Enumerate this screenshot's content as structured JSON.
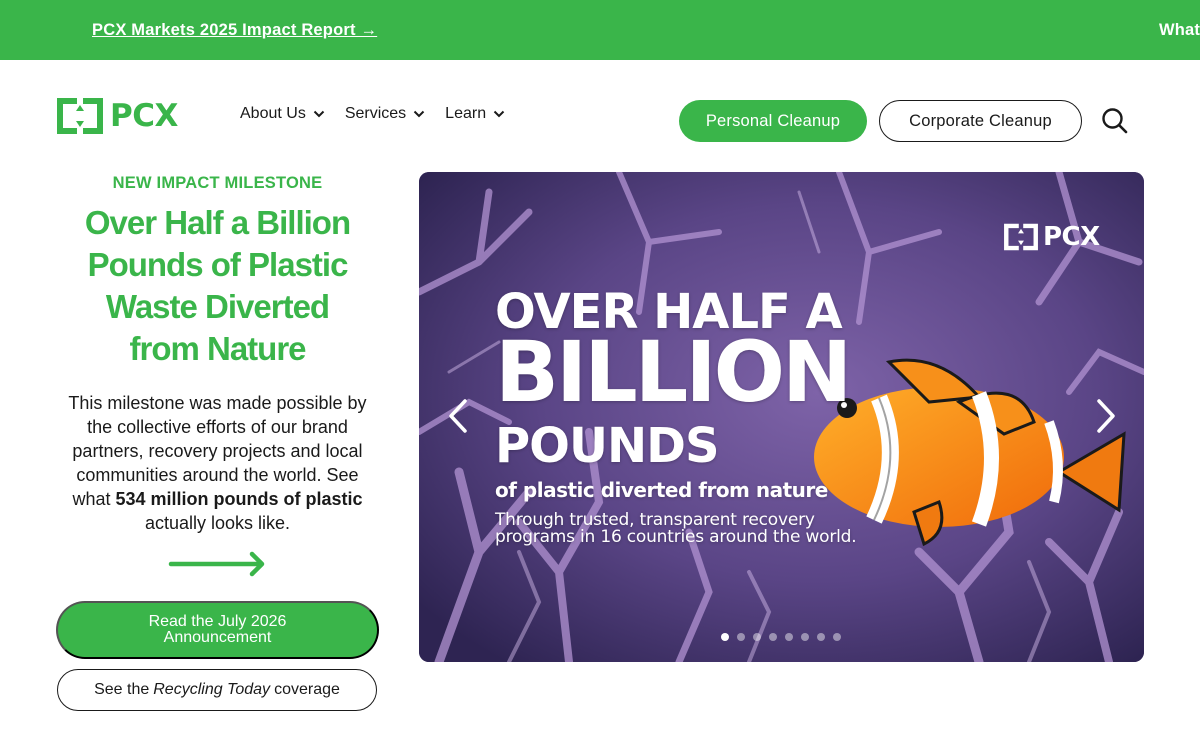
{
  "announcement": {
    "primary_link": "PCX Markets 2025 Impact Report →",
    "secondary_link": "What"
  },
  "header": {
    "logo_text": "PCX",
    "nav": [
      {
        "label": "About Us"
      },
      {
        "label": "Services"
      },
      {
        "label": "Learn"
      }
    ],
    "personal_cleanup": "Personal Cleanup",
    "corporate_cleanup": "Corporate Cleanup"
  },
  "hero": {
    "eyebrow": "NEW IMPACT MILESTONE",
    "headline_lines": [
      "Over Half a Billion",
      "Pounds of Plastic",
      "Waste Diverted",
      "from Nature"
    ],
    "body_before": "This milestone was made possible by the collective efforts of our brand partners, recovery projects and local communities around the world. See what ",
    "body_bold": "534 million pounds of plastic",
    "body_after": " actually looks like.",
    "read_button": "Read the July 2026 Announcement",
    "coverage_prefix": "See the",
    "coverage_italic": "Recycling Today",
    "coverage_suffix": "coverage"
  },
  "carousel": {
    "logo_text": "PCX",
    "line1": "OVER HALF A",
    "line2": "BILLION",
    "line3": "POUNDS",
    "line4": "of plastic diverted from nature",
    "line5": "Through trusted, transparent recovery programs in 16 countries around the world.",
    "slide_count": 8,
    "active_index": 0
  },
  "colors": {
    "brand_green": "#3ab54a",
    "text_dark": "#1a1a1a"
  },
  "icons": {
    "search": "search-icon",
    "nav_chevron": "chevron-down-icon",
    "arrow": "arrow-right-icon",
    "prev": "chevron-left-icon",
    "next": "chevron-right-icon"
  }
}
